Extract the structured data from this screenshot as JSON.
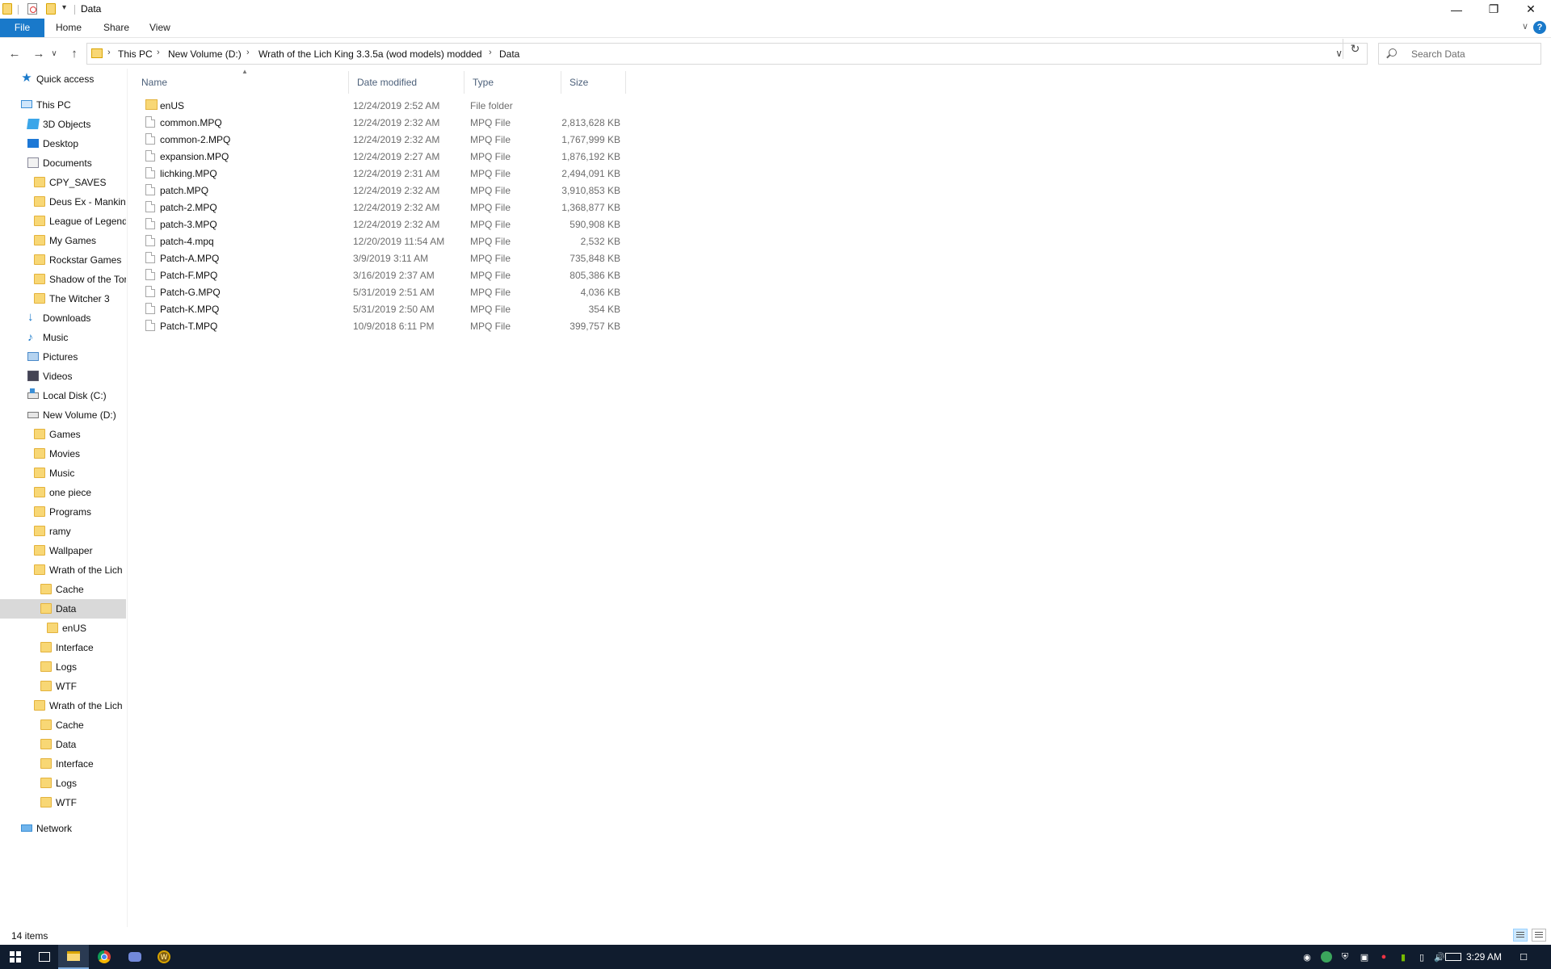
{
  "window": {
    "title": "Data"
  },
  "ribbon": {
    "tabs": [
      "File",
      "Home",
      "Share",
      "View"
    ],
    "help": "?"
  },
  "address": {
    "crumbs": [
      "This PC",
      "New Volume (D:)",
      "Wrath of the Lich King 3.3.5a (wod models) modded",
      "Data"
    ],
    "search_placeholder": "Search Data"
  },
  "columns": {
    "name": "Name",
    "date": "Date modified",
    "type": "Type",
    "size": "Size"
  },
  "files": [
    {
      "name": "enUS",
      "date": "12/24/2019 2:52 AM",
      "type": "File folder",
      "size": "",
      "kind": "folder"
    },
    {
      "name": "common.MPQ",
      "date": "12/24/2019 2:32 AM",
      "type": "MPQ File",
      "size": "2,813,628 KB",
      "kind": "file"
    },
    {
      "name": "common-2.MPQ",
      "date": "12/24/2019 2:32 AM",
      "type": "MPQ File",
      "size": "1,767,999 KB",
      "kind": "file"
    },
    {
      "name": "expansion.MPQ",
      "date": "12/24/2019 2:27 AM",
      "type": "MPQ File",
      "size": "1,876,192 KB",
      "kind": "file"
    },
    {
      "name": "lichking.MPQ",
      "date": "12/24/2019 2:31 AM",
      "type": "MPQ File",
      "size": "2,494,091 KB",
      "kind": "file"
    },
    {
      "name": "patch.MPQ",
      "date": "12/24/2019 2:32 AM",
      "type": "MPQ File",
      "size": "3,910,853 KB",
      "kind": "file"
    },
    {
      "name": "patch-2.MPQ",
      "date": "12/24/2019 2:32 AM",
      "type": "MPQ File",
      "size": "1,368,877 KB",
      "kind": "file"
    },
    {
      "name": "patch-3.MPQ",
      "date": "12/24/2019 2:32 AM",
      "type": "MPQ File",
      "size": "590,908 KB",
      "kind": "file"
    },
    {
      "name": "patch-4.mpq",
      "date": "12/20/2019 11:54 AM",
      "type": "MPQ File",
      "size": "2,532 KB",
      "kind": "file"
    },
    {
      "name": "Patch-A.MPQ",
      "date": "3/9/2019 3:11 AM",
      "type": "MPQ File",
      "size": "735,848 KB",
      "kind": "file"
    },
    {
      "name": "Patch-F.MPQ",
      "date": "3/16/2019 2:37 AM",
      "type": "MPQ File",
      "size": "805,386 KB",
      "kind": "file"
    },
    {
      "name": "Patch-G.MPQ",
      "date": "5/31/2019 2:51 AM",
      "type": "MPQ File",
      "size": "4,036 KB",
      "kind": "file"
    },
    {
      "name": "Patch-K.MPQ",
      "date": "5/31/2019 2:50 AM",
      "type": "MPQ File",
      "size": "354 KB",
      "kind": "file"
    },
    {
      "name": "Patch-T.MPQ",
      "date": "10/9/2018 6:11 PM",
      "type": "MPQ File",
      "size": "399,757 KB",
      "kind": "file"
    }
  ],
  "navpane": [
    {
      "label": "Quick access",
      "icon": "star-icon",
      "level": 0
    },
    {
      "label": "This PC",
      "icon": "computer-icon",
      "level": 0
    },
    {
      "label": "3D Objects",
      "icon": "cube-icon",
      "level": 1
    },
    {
      "label": "Desktop",
      "icon": "desktop-icon",
      "level": 1
    },
    {
      "label": "Documents",
      "icon": "documents-icon",
      "level": 1
    },
    {
      "label": "CPY_SAVES",
      "icon": "folder-icon",
      "level": 2
    },
    {
      "label": "Deus Ex -  Mankin",
      "icon": "folder-icon",
      "level": 2
    },
    {
      "label": "League of Legend",
      "icon": "folder-icon",
      "level": 2
    },
    {
      "label": "My Games",
      "icon": "folder-icon",
      "level": 2
    },
    {
      "label": "Rockstar Games",
      "icon": "folder-icon",
      "level": 2
    },
    {
      "label": "Shadow of the Tor",
      "icon": "folder-icon",
      "level": 2
    },
    {
      "label": "The Witcher 3",
      "icon": "folder-icon",
      "level": 2
    },
    {
      "label": "Downloads",
      "icon": "downloads-icon",
      "level": 1
    },
    {
      "label": "Music",
      "icon": "music-icon",
      "level": 1
    },
    {
      "label": "Pictures",
      "icon": "pictures-icon",
      "level": 1
    },
    {
      "label": "Videos",
      "icon": "videos-icon",
      "level": 1
    },
    {
      "label": "Local Disk (C:)",
      "icon": "drive-c-icon",
      "level": 1
    },
    {
      "label": "New Volume (D:)",
      "icon": "drive-icon",
      "level": 1
    },
    {
      "label": "Games",
      "icon": "folder-icon",
      "level": 2
    },
    {
      "label": "Movies",
      "icon": "folder-icon",
      "level": 2
    },
    {
      "label": "Music",
      "icon": "folder-icon",
      "level": 2
    },
    {
      "label": "one piece",
      "icon": "folder-icon",
      "level": 2
    },
    {
      "label": "Programs",
      "icon": "folder-icon",
      "level": 2
    },
    {
      "label": "ramy",
      "icon": "folder-icon",
      "level": 2
    },
    {
      "label": "Wallpaper",
      "icon": "folder-icon",
      "level": 2
    },
    {
      "label": "Wrath of the Lich",
      "icon": "folder-icon",
      "level": 2
    },
    {
      "label": "Cache",
      "icon": "folder-icon",
      "level": 3
    },
    {
      "label": "Data",
      "icon": "folder-icon",
      "level": 3,
      "selected": true
    },
    {
      "label": "enUS",
      "icon": "folder-icon",
      "level": 4
    },
    {
      "label": "Interface",
      "icon": "folder-icon",
      "level": 3
    },
    {
      "label": "Logs",
      "icon": "folder-icon",
      "level": 3
    },
    {
      "label": "WTF",
      "icon": "folder-icon",
      "level": 3
    },
    {
      "label": "Wrath of the Lich",
      "icon": "folder-icon",
      "level": 2
    },
    {
      "label": "Cache",
      "icon": "folder-icon",
      "level": 3
    },
    {
      "label": "Data",
      "icon": "folder-icon",
      "level": 3
    },
    {
      "label": "Interface",
      "icon": "folder-icon",
      "level": 3
    },
    {
      "label": "Logs",
      "icon": "folder-icon",
      "level": 3
    },
    {
      "label": "WTF",
      "icon": "folder-icon",
      "level": 3
    },
    {
      "label": "Network",
      "icon": "network-icon",
      "level": 0
    }
  ],
  "status": {
    "item_count": "14 items"
  },
  "taskbar": {
    "clock": "3:29 AM",
    "wow_glyph": "W"
  }
}
